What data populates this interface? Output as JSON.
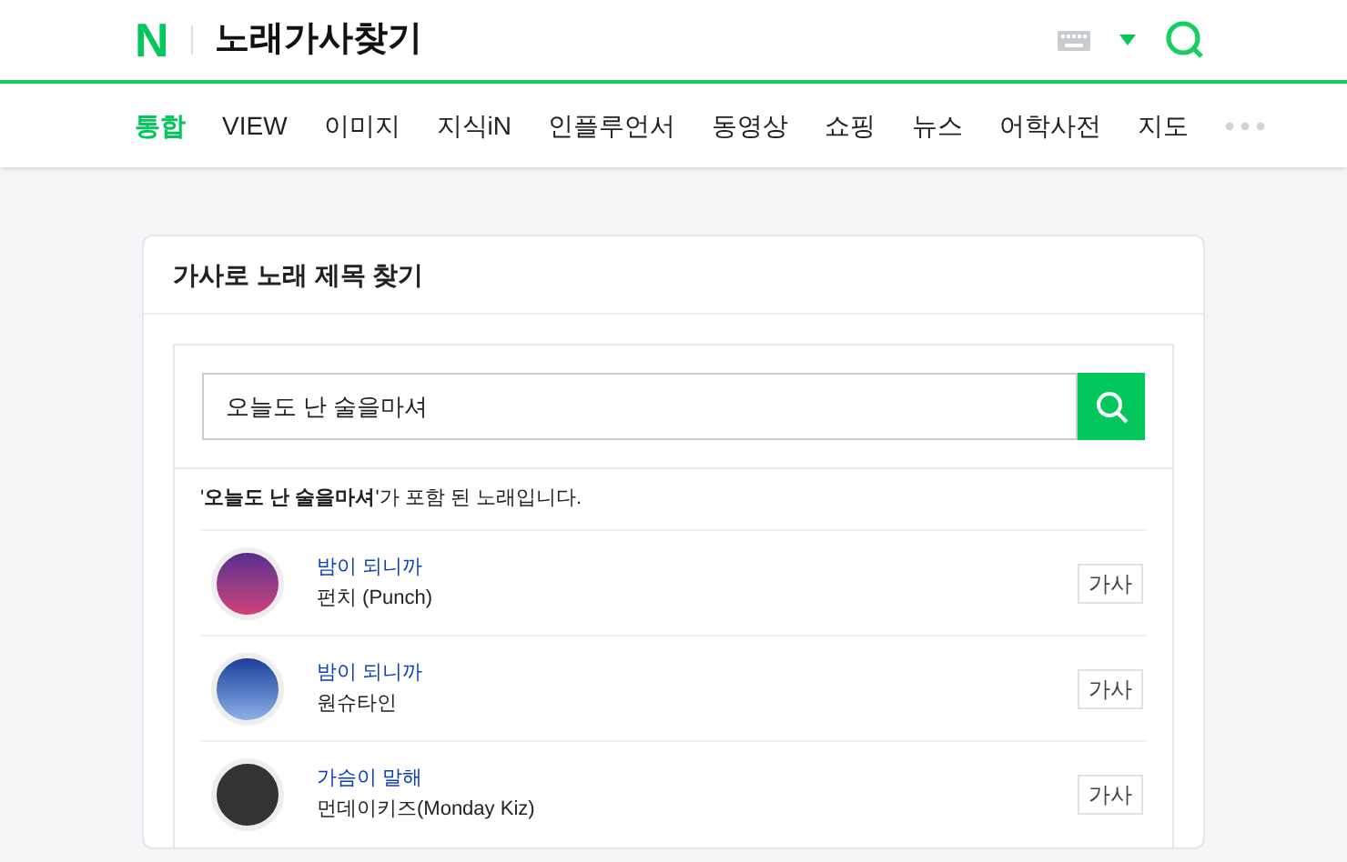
{
  "header": {
    "logo": "N",
    "title": "노래가사찾기"
  },
  "tabs": [
    {
      "label": "통합",
      "selected": true
    },
    {
      "label": "VIEW",
      "selected": false
    },
    {
      "label": "이미지",
      "selected": false
    },
    {
      "label": "지식iN",
      "selected": false
    },
    {
      "label": "인플루언서",
      "selected": false
    },
    {
      "label": "동영상",
      "selected": false
    },
    {
      "label": "쇼핑",
      "selected": false
    },
    {
      "label": "뉴스",
      "selected": false
    },
    {
      "label": "어학사전",
      "selected": false
    },
    {
      "label": "지도",
      "selected": false
    }
  ],
  "card": {
    "title": "가사로 노래 제목 찾기",
    "search": {
      "value": "오늘도 난 술을마셔"
    },
    "result_text": "'**오늘도 난 술을마셔**'가 포함 된 노래입니다.",
    "songs": [
      {
        "title": "밤이 되니까",
        "artist": "펀치 (Punch)",
        "button": "가사"
      },
      {
        "title": "밤이 되니까",
        "artist": "원슈타인",
        "button": "가사"
      },
      {
        "title": "가슴이 말해",
        "artist": "먼데이키즈(Monday Kiz)",
        "button": "가사"
      }
    ]
  }
}
